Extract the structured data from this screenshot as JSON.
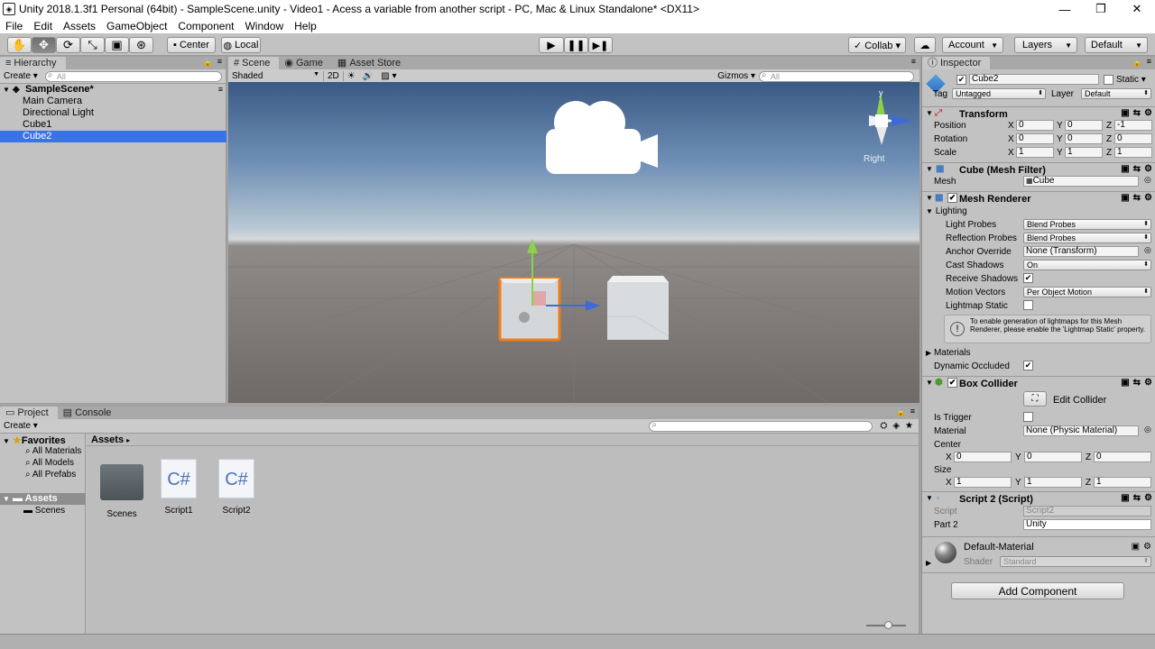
{
  "window": {
    "title": "Unity 2018.1.3f1 Personal (64bit) - SampleScene.unity - Video1 - Acess a variable from another script - PC, Mac & Linux Standalone* <DX11>",
    "minimize": "—",
    "maximize": "❐",
    "close": "✕"
  },
  "menu": [
    "File",
    "Edit",
    "Assets",
    "GameObject",
    "Component",
    "Window",
    "Help"
  ],
  "toolbar": {
    "center": "Center",
    "local": "Local",
    "collab": "Collab ▾",
    "account": "Account",
    "layers": "Layers",
    "layout": "Default"
  },
  "hierarchy": {
    "tab": "Hierarchy",
    "create": "Create",
    "search_placeholder": "All",
    "scene": "SampleScene*",
    "items": [
      "Main Camera",
      "Directional Light",
      "Cube1",
      "Cube2"
    ]
  },
  "scene": {
    "tabs": [
      "Scene",
      "Game",
      "Asset Store"
    ],
    "shading": "Shaded",
    "mode2d": "2D",
    "gizmos": "Gizmos",
    "search_placeholder": "All",
    "gizmo_view": "Right",
    "axis_y": "y"
  },
  "project": {
    "tabs": [
      "Project",
      "Console"
    ],
    "create": "Create",
    "favorites": "Favorites",
    "favorite_items": [
      "All Materials",
      "All Models",
      "All Prefabs"
    ],
    "assets": "Assets",
    "asset_folders": [
      "Scenes"
    ],
    "breadcrumb": "Assets",
    "items": [
      {
        "name": "Scenes",
        "kind": "folder"
      },
      {
        "name": "Script1",
        "kind": "script",
        "glyph": "C#"
      },
      {
        "name": "Script2",
        "kind": "script",
        "glyph": "C#"
      }
    ]
  },
  "inspector": {
    "tab": "Inspector",
    "object_name": "Cube2",
    "static_label": "Static",
    "tag_label": "Tag",
    "tag_value": "Untagged",
    "layer_label": "Layer",
    "layer_value": "Default",
    "transform": {
      "title": "Transform",
      "position_label": "Position",
      "position": [
        "0",
        "0",
        "-1"
      ],
      "rotation_label": "Rotation",
      "rotation": [
        "0",
        "0",
        "0"
      ],
      "scale_label": "Scale",
      "scale": [
        "1",
        "1",
        "1"
      ]
    },
    "mesh_filter": {
      "title": "Cube (Mesh Filter)",
      "mesh_label": "Mesh",
      "mesh_value": "Cube"
    },
    "mesh_renderer": {
      "title": "Mesh Renderer",
      "lighting": "Lighting",
      "light_probes_label": "Light Probes",
      "light_probes": "Blend Probes",
      "reflection_probes_label": "Reflection Probes",
      "reflection_probes": "Blend Probes",
      "anchor_override_label": "Anchor Override",
      "anchor_override": "None (Transform)",
      "cast_shadows_label": "Cast Shadows",
      "cast_shadows": "On",
      "receive_shadows_label": "Receive Shadows",
      "motion_vectors_label": "Motion Vectors",
      "motion_vectors": "Per Object Motion",
      "lightmap_static_label": "Lightmap Static",
      "info": "To enable generation of lightmaps for this Mesh Renderer, please enable the 'Lightmap Static' property.",
      "materials_label": "Materials",
      "dynamic_occluded_label": "Dynamic Occluded"
    },
    "box_collider": {
      "title": "Box Collider",
      "edit_collider": "Edit Collider",
      "is_trigger_label": "Is Trigger",
      "material_label": "Material",
      "material": "None (Physic Material)",
      "center_label": "Center",
      "center": [
        "0",
        "0",
        "0"
      ],
      "size_label": "Size",
      "size": [
        "1",
        "1",
        "1"
      ]
    },
    "script2": {
      "title": "Script 2 (Script)",
      "script_label": "Script",
      "script_value": "Script2",
      "part2_label": "Part 2",
      "part2_value": "Unity"
    },
    "material": {
      "name": "Default-Material",
      "shader_label": "Shader",
      "shader_value": "Standard"
    },
    "add_component": "Add Component"
  }
}
